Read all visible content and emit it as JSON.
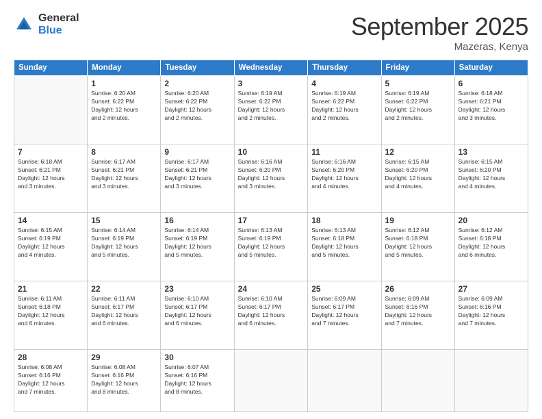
{
  "logo": {
    "general": "General",
    "blue": "Blue"
  },
  "title": "September 2025",
  "subtitle": "Mazeras, Kenya",
  "headers": [
    "Sunday",
    "Monday",
    "Tuesday",
    "Wednesday",
    "Thursday",
    "Friday",
    "Saturday"
  ],
  "weeks": [
    [
      {
        "day": "",
        "info": ""
      },
      {
        "day": "1",
        "info": "Sunrise: 6:20 AM\nSunset: 6:22 PM\nDaylight: 12 hours\nand 2 minutes."
      },
      {
        "day": "2",
        "info": "Sunrise: 6:20 AM\nSunset: 6:22 PM\nDaylight: 12 hours\nand 2 minutes."
      },
      {
        "day": "3",
        "info": "Sunrise: 6:19 AM\nSunset: 6:22 PM\nDaylight: 12 hours\nand 2 minutes."
      },
      {
        "day": "4",
        "info": "Sunrise: 6:19 AM\nSunset: 6:22 PM\nDaylight: 12 hours\nand 2 minutes."
      },
      {
        "day": "5",
        "info": "Sunrise: 6:19 AM\nSunset: 6:22 PM\nDaylight: 12 hours\nand 2 minutes."
      },
      {
        "day": "6",
        "info": "Sunrise: 6:18 AM\nSunset: 6:21 PM\nDaylight: 12 hours\nand 3 minutes."
      }
    ],
    [
      {
        "day": "7",
        "info": "Sunrise: 6:18 AM\nSunset: 6:21 PM\nDaylight: 12 hours\nand 3 minutes."
      },
      {
        "day": "8",
        "info": "Sunrise: 6:17 AM\nSunset: 6:21 PM\nDaylight: 12 hours\nand 3 minutes."
      },
      {
        "day": "9",
        "info": "Sunrise: 6:17 AM\nSunset: 6:21 PM\nDaylight: 12 hours\nand 3 minutes."
      },
      {
        "day": "10",
        "info": "Sunrise: 6:16 AM\nSunset: 6:20 PM\nDaylight: 12 hours\nand 3 minutes."
      },
      {
        "day": "11",
        "info": "Sunrise: 6:16 AM\nSunset: 6:20 PM\nDaylight: 12 hours\nand 4 minutes."
      },
      {
        "day": "12",
        "info": "Sunrise: 6:15 AM\nSunset: 6:20 PM\nDaylight: 12 hours\nand 4 minutes."
      },
      {
        "day": "13",
        "info": "Sunrise: 6:15 AM\nSunset: 6:20 PM\nDaylight: 12 hours\nand 4 minutes."
      }
    ],
    [
      {
        "day": "14",
        "info": "Sunrise: 6:15 AM\nSunset: 6:19 PM\nDaylight: 12 hours\nand 4 minutes."
      },
      {
        "day": "15",
        "info": "Sunrise: 6:14 AM\nSunset: 6:19 PM\nDaylight: 12 hours\nand 5 minutes."
      },
      {
        "day": "16",
        "info": "Sunrise: 6:14 AM\nSunset: 6:19 PM\nDaylight: 12 hours\nand 5 minutes."
      },
      {
        "day": "17",
        "info": "Sunrise: 6:13 AM\nSunset: 6:19 PM\nDaylight: 12 hours\nand 5 minutes."
      },
      {
        "day": "18",
        "info": "Sunrise: 6:13 AM\nSunset: 6:18 PM\nDaylight: 12 hours\nand 5 minutes."
      },
      {
        "day": "19",
        "info": "Sunrise: 6:12 AM\nSunset: 6:18 PM\nDaylight: 12 hours\nand 5 minutes."
      },
      {
        "day": "20",
        "info": "Sunrise: 6:12 AM\nSunset: 6:18 PM\nDaylight: 12 hours\nand 6 minutes."
      }
    ],
    [
      {
        "day": "21",
        "info": "Sunrise: 6:11 AM\nSunset: 6:18 PM\nDaylight: 12 hours\nand 6 minutes."
      },
      {
        "day": "22",
        "info": "Sunrise: 6:11 AM\nSunset: 6:17 PM\nDaylight: 12 hours\nand 6 minutes."
      },
      {
        "day": "23",
        "info": "Sunrise: 6:10 AM\nSunset: 6:17 PM\nDaylight: 12 hours\nand 6 minutes."
      },
      {
        "day": "24",
        "info": "Sunrise: 6:10 AM\nSunset: 6:17 PM\nDaylight: 12 hours\nand 6 minutes."
      },
      {
        "day": "25",
        "info": "Sunrise: 6:09 AM\nSunset: 6:17 PM\nDaylight: 12 hours\nand 7 minutes."
      },
      {
        "day": "26",
        "info": "Sunrise: 6:09 AM\nSunset: 6:16 PM\nDaylight: 12 hours\nand 7 minutes."
      },
      {
        "day": "27",
        "info": "Sunrise: 6:09 AM\nSunset: 6:16 PM\nDaylight: 12 hours\nand 7 minutes."
      }
    ],
    [
      {
        "day": "28",
        "info": "Sunrise: 6:08 AM\nSunset: 6:16 PM\nDaylight: 12 hours\nand 7 minutes."
      },
      {
        "day": "29",
        "info": "Sunrise: 6:08 AM\nSunset: 6:16 PM\nDaylight: 12 hours\nand 8 minutes."
      },
      {
        "day": "30",
        "info": "Sunrise: 6:07 AM\nSunset: 6:16 PM\nDaylight: 12 hours\nand 8 minutes."
      },
      {
        "day": "",
        "info": ""
      },
      {
        "day": "",
        "info": ""
      },
      {
        "day": "",
        "info": ""
      },
      {
        "day": "",
        "info": ""
      }
    ]
  ]
}
